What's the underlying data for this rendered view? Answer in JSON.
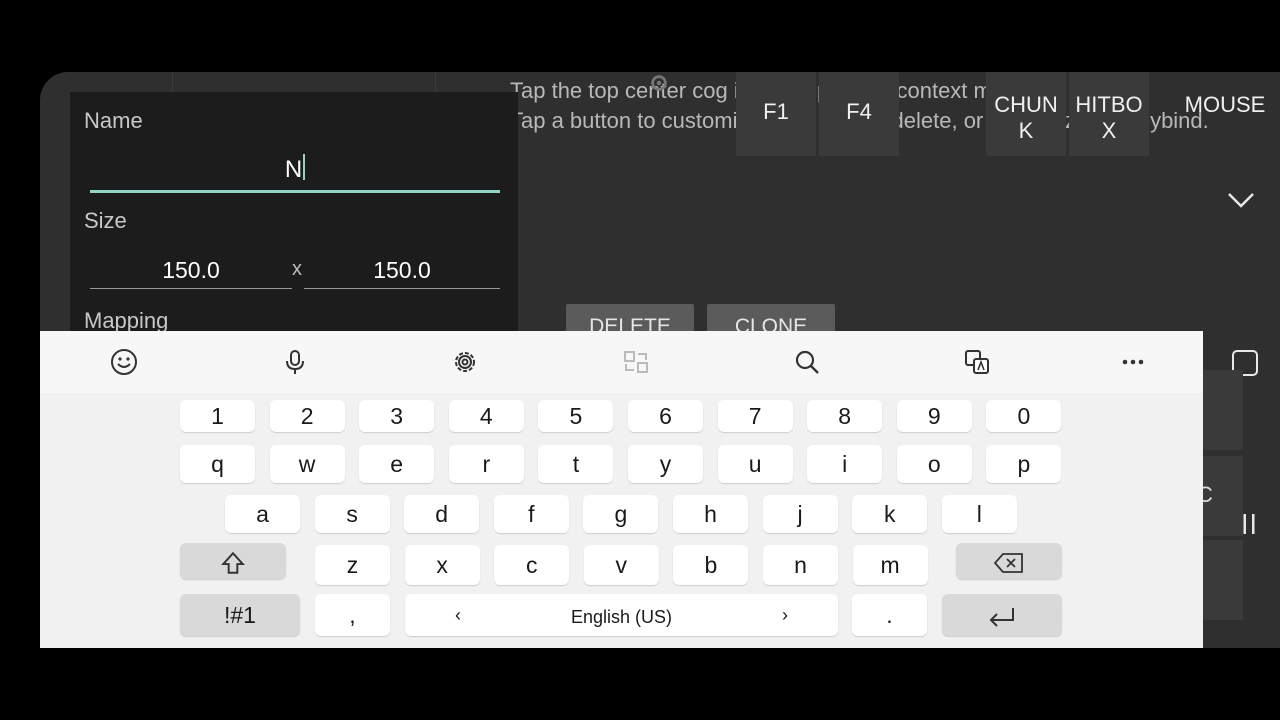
{
  "hint": {
    "line1": "Tap the top center cog icon to open the context menu.",
    "line2": "Tap a button to customize: edit, resize, delete, or customize it's keybind."
  },
  "controls": {
    "f1": "F1",
    "f4": "F4",
    "chunk_line1": "CHUN",
    "chunk_line2": "K",
    "hitbox_line1": "HITBO",
    "hitbox_line2": "X",
    "mouse": "MOUSE",
    "right1": "I",
    "right2": "C"
  },
  "actions": {
    "delete": "DELETE",
    "clone": "CLONE"
  },
  "editor": {
    "name_label": "Name",
    "name_value": "N",
    "size_label": "Size",
    "width_value": "150.0",
    "size_separator": "x",
    "height_value": "150.0",
    "mapping_label": "Mapping"
  },
  "keyboard": {
    "row_numbers": [
      "1",
      "2",
      "3",
      "4",
      "5",
      "6",
      "7",
      "8",
      "9",
      "0"
    ],
    "row_q": [
      "q",
      "w",
      "e",
      "r",
      "t",
      "y",
      "u",
      "i",
      "o",
      "p"
    ],
    "row_a": [
      "a",
      "s",
      "d",
      "f",
      "g",
      "h",
      "j",
      "k",
      "l"
    ],
    "row_z": [
      "z",
      "x",
      "c",
      "v",
      "b",
      "n",
      "m"
    ],
    "symbols_label": "!#1",
    "comma": ",",
    "space_label": "English (US)",
    "space_left": "‹",
    "space_right": "›",
    "period": "."
  },
  "colors": {
    "accent": "#8fd6c4",
    "panel": "#1c1c1c",
    "background": "#2f2f2f"
  }
}
